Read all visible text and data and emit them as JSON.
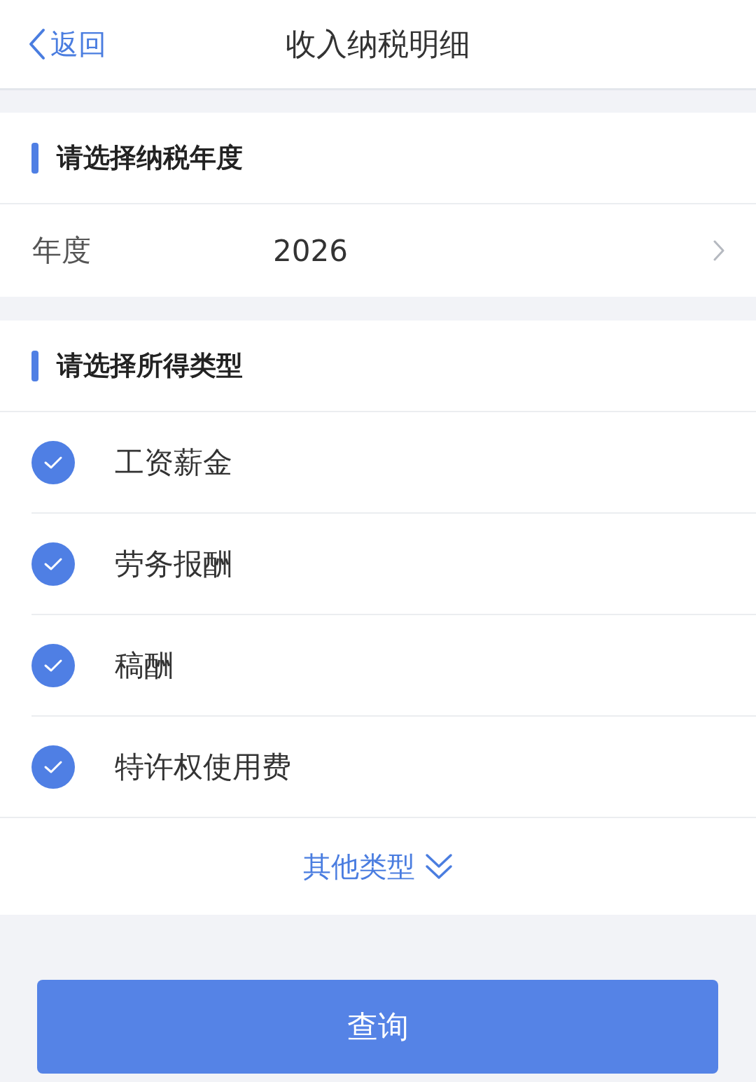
{
  "header": {
    "back": "返回",
    "title": "收入纳税明细"
  },
  "year_section": {
    "title": "请选择纳税年度",
    "label": "年度",
    "value": "2026"
  },
  "type_section": {
    "title": "请选择所得类型",
    "items": [
      {
        "label": "工资薪金",
        "checked": true
      },
      {
        "label": "劳务报酬",
        "checked": true
      },
      {
        "label": "稿酬",
        "checked": true
      },
      {
        "label": "特许权使用费",
        "checked": true
      }
    ],
    "more": "其他类型"
  },
  "submit": "查询"
}
